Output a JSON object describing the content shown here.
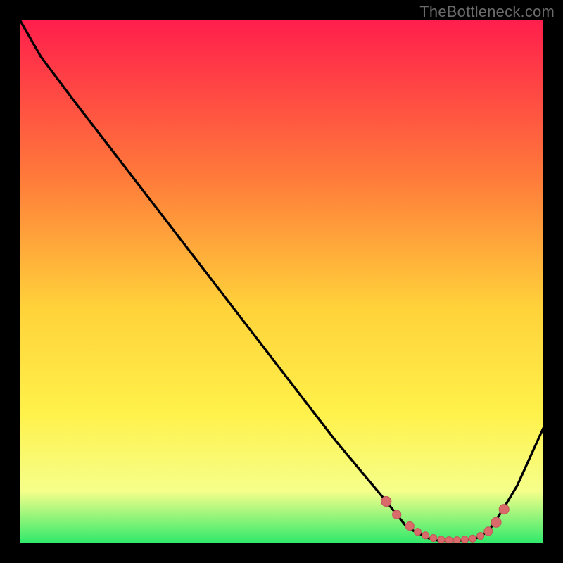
{
  "watermark": "TheBottleneck.com",
  "colors": {
    "frame": "#000000",
    "grad_top": "#ff1e4c",
    "grad_mid1": "#ff7a3a",
    "grad_mid2": "#ffd23a",
    "grad_mid3": "#fff14a",
    "grad_low": "#f6ff8a",
    "grad_bottom": "#2fe96b",
    "curve": "#000000",
    "marker_fill": "#d96b6b",
    "marker_stroke": "#c45a5a"
  },
  "chart_data": {
    "type": "line",
    "title": "",
    "xlabel": "",
    "ylabel": "",
    "xlim": [
      0,
      100
    ],
    "ylim": [
      0,
      100
    ],
    "series": [
      {
        "name": "bottleneck-curve",
        "x": [
          0,
          4,
          10,
          20,
          30,
          40,
          50,
          60,
          70,
          74,
          78,
          80,
          82,
          84,
          86,
          88,
          90,
          92,
          95,
          100
        ],
        "y": [
          100,
          93,
          85,
          72,
          59,
          46,
          33,
          20,
          8,
          3,
          1,
          0.5,
          0.5,
          0.5,
          0.7,
          1.2,
          3,
          6,
          11,
          22
        ]
      }
    ],
    "markers": {
      "name": "emphasis-dots",
      "x": [
        70,
        72,
        74.5,
        76,
        77.5,
        79,
        80.5,
        82,
        83.5,
        85,
        86.5,
        88,
        89.5,
        91,
        92.5
      ],
      "y": [
        8,
        5.5,
        3.3,
        2.2,
        1.5,
        1.0,
        0.7,
        0.6,
        0.6,
        0.7,
        0.9,
        1.4,
        2.3,
        4.0,
        6.5
      ],
      "r": [
        7,
        6,
        6,
        5,
        5,
        5,
        5,
        5,
        5,
        5,
        5,
        5,
        6,
        7,
        7
      ]
    }
  }
}
